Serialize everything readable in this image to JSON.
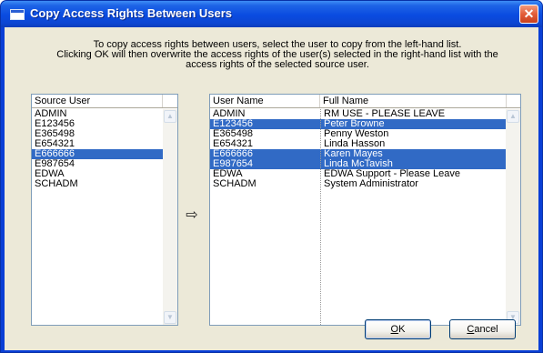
{
  "window": {
    "title": "Copy Access Rights Between Users",
    "close_glyph": "✕"
  },
  "instructions": [
    "To copy access rights between users, select the user to copy from the left-hand list.",
    "Clicking OK will then overwrite the access rights of the user(s) selected in the right-hand list with the",
    "access rights of the selected source user."
  ],
  "source_list": {
    "header": "Source User",
    "items": [
      {
        "label": "ADMIN",
        "selected": false
      },
      {
        "label": "E123456",
        "selected": false
      },
      {
        "label": "E365498",
        "selected": false
      },
      {
        "label": "E654321",
        "selected": false
      },
      {
        "label": "E666666",
        "selected": true
      },
      {
        "label": "E987654",
        "selected": false
      },
      {
        "label": "EDWA",
        "selected": false
      },
      {
        "label": "SCHADM",
        "selected": false
      }
    ]
  },
  "arrow_glyph": "⇨",
  "target_list": {
    "headers": [
      "User Name",
      "Full Name"
    ],
    "rows": [
      {
        "user": "ADMIN",
        "full": "RM USE - PLEASE LEAVE",
        "selected": false
      },
      {
        "user": "E123456",
        "full": "Peter Browne",
        "selected": true
      },
      {
        "user": "E365498",
        "full": "Penny Weston",
        "selected": false
      },
      {
        "user": "E654321",
        "full": "Linda Hasson",
        "selected": false
      },
      {
        "user": "E666666",
        "full": "Karen Mayes",
        "selected": true
      },
      {
        "user": "E987654",
        "full": "Linda McTavish",
        "selected": true
      },
      {
        "user": "EDWA",
        "full": "EDWA Support - Please Leave",
        "selected": false
      },
      {
        "user": "SCHADM",
        "full": "System Administrator",
        "selected": false
      }
    ]
  },
  "buttons": {
    "ok_mnemonic": "O",
    "ok_rest": "K",
    "cancel_mnemonic": "C",
    "cancel_rest": "ancel"
  },
  "colors": {
    "selection": "#316ac5",
    "titlebar": "#0a4be0",
    "dialog_face": "#ece9d8"
  }
}
